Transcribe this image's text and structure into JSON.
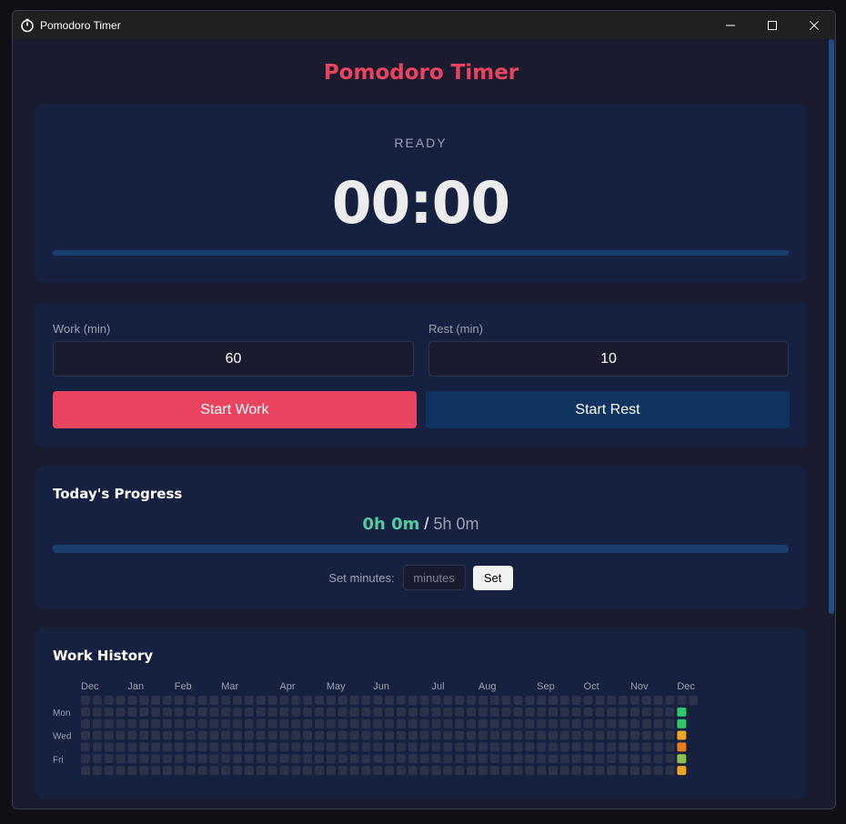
{
  "window": {
    "title": "Pomodoro Timer"
  },
  "app": {
    "title": "Pomodoro Timer"
  },
  "timer": {
    "status": "READY",
    "display": "00:00",
    "progress": 0
  },
  "settings": {
    "work_label": "Work (min)",
    "work_value": "60",
    "rest_label": "Rest (min)",
    "rest_value": "10",
    "start_work_label": "Start Work",
    "start_rest_label": "Start Rest"
  },
  "progress": {
    "title": "Today's Progress",
    "done": "0h 0m",
    "separator": " / ",
    "goal": "5h 0m",
    "fraction": 0,
    "set_label": "Set minutes:",
    "minutes_placeholder": "minutes",
    "set_button": "Set"
  },
  "history": {
    "title": "Work History",
    "months": [
      "Dec",
      "Jan",
      "Feb",
      "Mar",
      "Apr",
      "May",
      "Jun",
      "Jul",
      "Aug",
      "Sep",
      "Oct",
      "Nov",
      "Dec"
    ],
    "days": [
      "Mon",
      "Wed",
      "Fri"
    ],
    "level_colors": {
      "empty": "#2b3249",
      "low": "#8bc34a",
      "mid": "#2ec86b",
      "high": "#f0a520",
      "max": "#ec7a18"
    },
    "last_week_levels": [
      "empty",
      "mid",
      "mid",
      "high",
      "max",
      "low",
      "high"
    ],
    "total_weeks": 53
  },
  "colors": {
    "accent": "#e8435f",
    "accent_secondary": "#0f3460",
    "success": "#4ecca3",
    "background": "#1a1b2e",
    "card": "#162040"
  }
}
